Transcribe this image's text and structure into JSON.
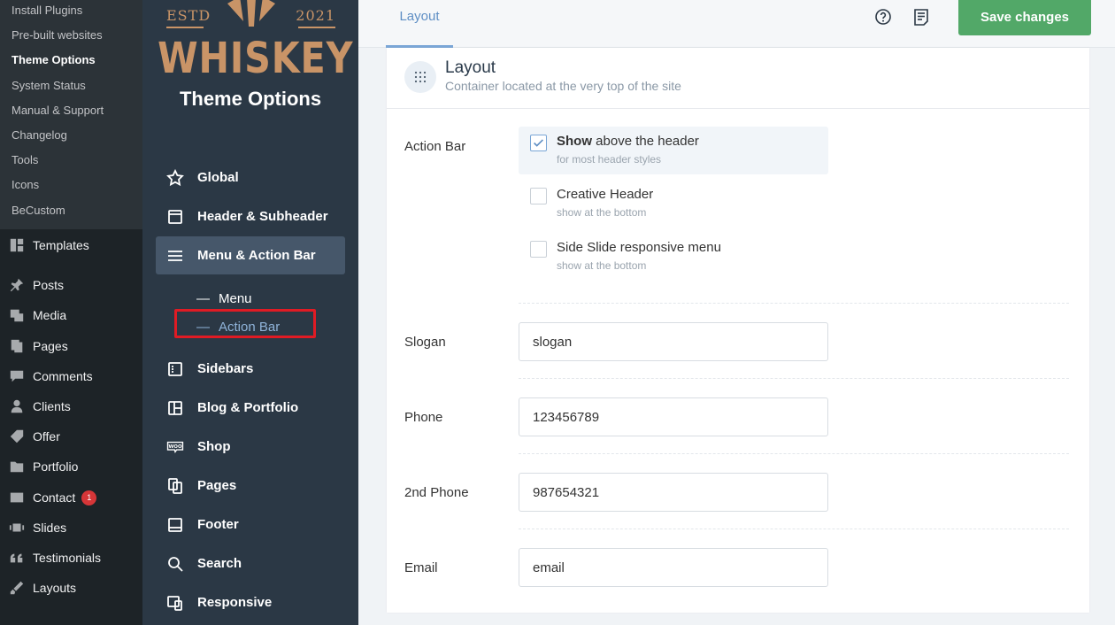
{
  "wp_menu": {
    "submenu": [
      "Install Plugins",
      "Pre-built websites",
      "Theme Options",
      "System Status",
      "Manual & Support",
      "Changelog",
      "Tools",
      "Icons",
      "BeCustom"
    ],
    "items": [
      {
        "label": "Templates",
        "icon": "templates-icon"
      },
      {
        "label": "Posts",
        "icon": "pin-icon"
      },
      {
        "label": "Media",
        "icon": "media-icon"
      },
      {
        "label": "Pages",
        "icon": "pages-icon"
      },
      {
        "label": "Comments",
        "icon": "comment-icon"
      },
      {
        "label": "Clients",
        "icon": "user-icon"
      },
      {
        "label": "Offer",
        "icon": "tag-icon"
      },
      {
        "label": "Portfolio",
        "icon": "folder-icon"
      },
      {
        "label": "Contact",
        "icon": "mail-icon",
        "badge": "1"
      },
      {
        "label": "Slides",
        "icon": "slides-icon"
      },
      {
        "label": "Testimonials",
        "icon": "quote-icon"
      },
      {
        "label": "Layouts",
        "icon": "brush-icon"
      }
    ]
  },
  "logo": {
    "estd": "ESTD",
    "year": "2021",
    "brand": "WHISKEY",
    "subtitle": "Theme Options"
  },
  "theme_nav": {
    "items": [
      {
        "label": "Global",
        "icon": "star-icon"
      },
      {
        "label": "Header & Subheader",
        "icon": "header-icon"
      },
      {
        "label": "Menu & Action Bar",
        "icon": "menu-icon"
      },
      {
        "label": "Sidebars",
        "icon": "sidebar-icon"
      },
      {
        "label": "Blog & Portfolio",
        "icon": "blog-icon"
      },
      {
        "label": "Shop",
        "icon": "woo-icon"
      },
      {
        "label": "Pages",
        "icon": "pages-icon"
      },
      {
        "label": "Footer",
        "icon": "footer-icon"
      },
      {
        "label": "Search",
        "icon": "search-icon"
      },
      {
        "label": "Responsive",
        "icon": "responsive-icon"
      }
    ],
    "sub_items": [
      "Menu",
      "Action Bar"
    ],
    "dash": "—"
  },
  "topbar": {
    "tab": "Layout",
    "save": "Save changes"
  },
  "panel": {
    "title": "Layout",
    "description": "Container located at the very top of the site",
    "action_bar_label": "Action Bar",
    "options": [
      {
        "bold": "Show",
        "title": " above the header",
        "sub": "for most header styles",
        "checked": true
      },
      {
        "bold": "",
        "title": "Creative Header",
        "sub": "show at the bottom",
        "checked": false
      },
      {
        "bold": "",
        "title": "Side Slide responsive menu",
        "sub": "show at the bottom",
        "checked": false
      }
    ],
    "fields": [
      {
        "label": "Slogan",
        "value": "slogan"
      },
      {
        "label": "Phone",
        "value": "123456789"
      },
      {
        "label": "2nd Phone",
        "value": "987654321"
      },
      {
        "label": "Email",
        "value": "email"
      }
    ]
  },
  "colors": {
    "save": "#52a868",
    "active_sub": "#8fb3d9",
    "brand": "#c99467",
    "highlight": "#e01b24"
  }
}
